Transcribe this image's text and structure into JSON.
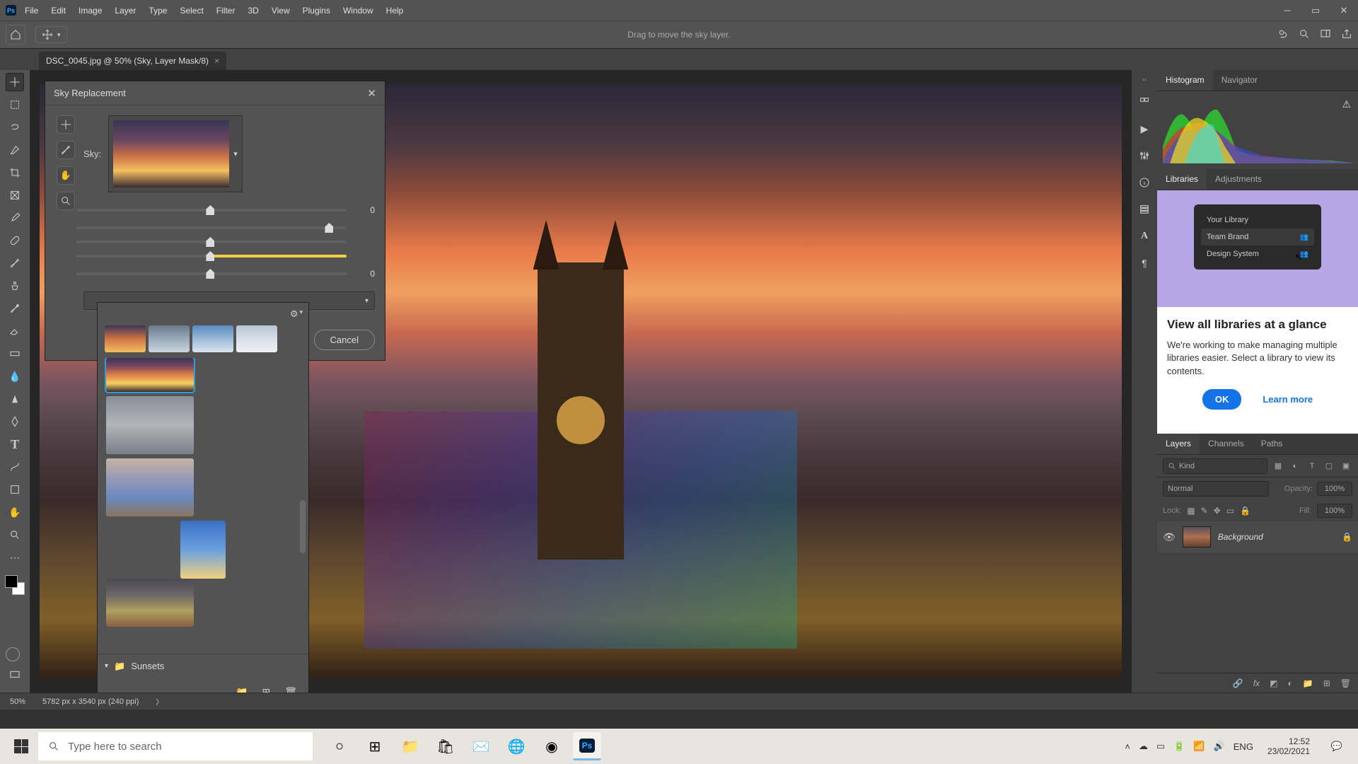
{
  "menus": {
    "file": "File",
    "edit": "Edit",
    "image": "Image",
    "layer": "Layer",
    "type": "Type",
    "select": "Select",
    "filter": "Filter",
    "three_d": "3D",
    "view": "View",
    "plugins": "Plugins",
    "window": "Window",
    "help": "Help"
  },
  "options_hint": "Drag to move the sky layer.",
  "doc_tab": "DSC_0045.jpg @ 50% (Sky, Layer Mask/8)",
  "dialog": {
    "title": "Sky Replacement",
    "sky_label": "Sky:",
    "vals": {
      "v1": "0",
      "v2": "",
      "v3": "0"
    },
    "cancel": "Cancel",
    "folder": "Sunsets"
  },
  "right_tabs": {
    "histogram": "Histogram",
    "navigator": "Navigator",
    "libraries": "Libraries",
    "adjustments": "Adjustments",
    "layers": "Layers",
    "channels": "Channels",
    "paths": "Paths"
  },
  "libraries": {
    "l1": "Your Library",
    "l2": "Team Brand",
    "l3": "Design System",
    "title": "View all libraries at a glance",
    "desc": "We're working to make managing multiple libraries easier. Select a library to view its contents.",
    "ok": "OK",
    "learn": "Learn more"
  },
  "layers": {
    "kind_placeholder": "Kind",
    "blend": "Normal",
    "opacity_label": "Opacity:",
    "opacity_val": "100%",
    "lock_label": "Lock:",
    "fill_label": "Fill:",
    "fill_val": "100%",
    "layer_name": "Background"
  },
  "status": {
    "zoom": "50%",
    "dims": "5782 px x 3540 px (240 ppi)"
  },
  "taskbar": {
    "search_placeholder": "Type here to search",
    "lang": "ENG",
    "time": "12:52",
    "date": "23/02/2021"
  }
}
